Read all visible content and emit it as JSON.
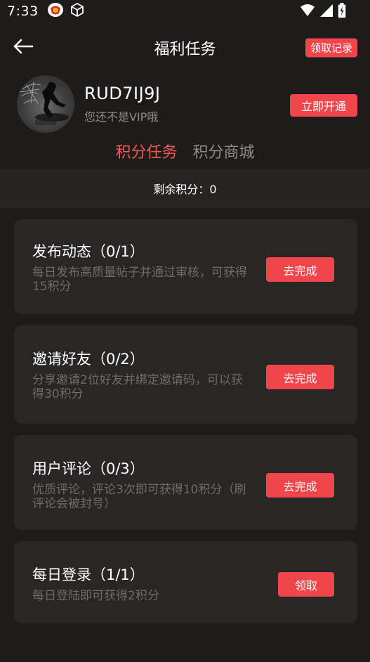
{
  "status_bar": {
    "time": "7:33",
    "left_icons": [
      "vpn-shield-icon",
      "cube-icon"
    ],
    "right_icons": [
      "wifi-icon",
      "cell-signal-icon",
      "battery-charging-icon"
    ]
  },
  "header": {
    "title": "福利任务",
    "back_icon": "arrow-left-icon",
    "records_label": "领取记录"
  },
  "profile": {
    "username": "RUD7IJ9J",
    "vip_note": "您还不是VIP哦",
    "open_vip_label": "立即开通"
  },
  "tabs": [
    {
      "label": "积分任务",
      "active": true
    },
    {
      "label": "积分商城",
      "active": false
    }
  ],
  "points": {
    "text": "剩余积分：0"
  },
  "tasks": [
    {
      "title": "发布动态（0/1）",
      "desc": "每日发布高质量帖子并通过审核，可获得15积分",
      "button": "去完成"
    },
    {
      "title": "邀请好友（0/2）",
      "desc": "分享邀请2位好友并绑定邀请码，可以获得30积分",
      "button": "去完成"
    },
    {
      "title": "用户评论（0/3）",
      "desc": "优质评论，评论3次即可获得10积分（刷评论会被封号）",
      "button": "去完成"
    },
    {
      "title": "每日登录（1/1）",
      "desc": "每日登陆即可获得2积分",
      "button": "领取"
    }
  ],
  "colors": {
    "accent": "#f0454b",
    "background": "#1e1b1b",
    "card": "#292626",
    "muted_text": "#6f6b6b"
  }
}
